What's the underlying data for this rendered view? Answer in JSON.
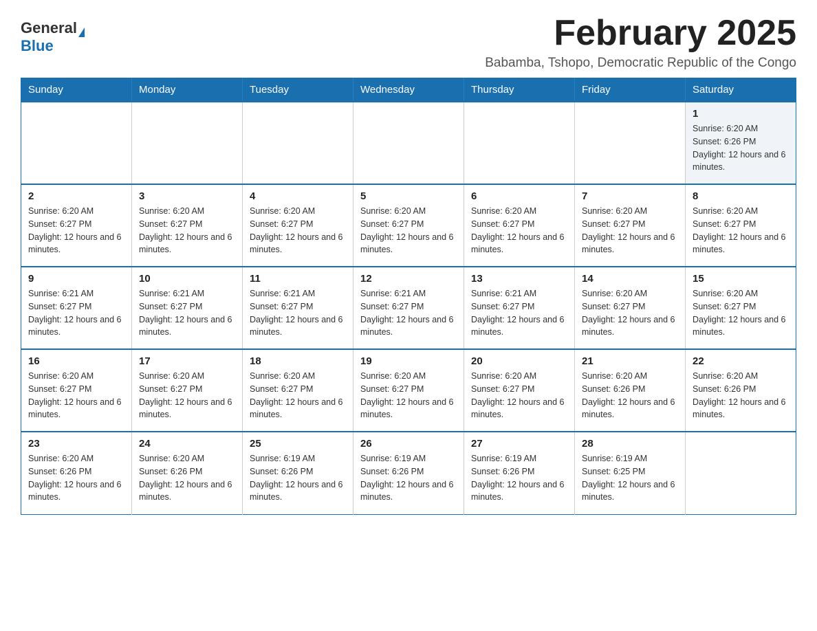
{
  "logo": {
    "general": "General",
    "blue": "Blue"
  },
  "header": {
    "month_year": "February 2025",
    "location": "Babamba, Tshopo, Democratic Republic of the Congo"
  },
  "weekdays": [
    "Sunday",
    "Monday",
    "Tuesday",
    "Wednesday",
    "Thursday",
    "Friday",
    "Saturday"
  ],
  "weeks": [
    {
      "days": [
        {
          "number": "",
          "info": ""
        },
        {
          "number": "",
          "info": ""
        },
        {
          "number": "",
          "info": ""
        },
        {
          "number": "",
          "info": ""
        },
        {
          "number": "",
          "info": ""
        },
        {
          "number": "",
          "info": ""
        },
        {
          "number": "1",
          "info": "Sunrise: 6:20 AM\nSunset: 6:26 PM\nDaylight: 12 hours and 6 minutes."
        }
      ]
    },
    {
      "days": [
        {
          "number": "2",
          "info": "Sunrise: 6:20 AM\nSunset: 6:27 PM\nDaylight: 12 hours and 6 minutes."
        },
        {
          "number": "3",
          "info": "Sunrise: 6:20 AM\nSunset: 6:27 PM\nDaylight: 12 hours and 6 minutes."
        },
        {
          "number": "4",
          "info": "Sunrise: 6:20 AM\nSunset: 6:27 PM\nDaylight: 12 hours and 6 minutes."
        },
        {
          "number": "5",
          "info": "Sunrise: 6:20 AM\nSunset: 6:27 PM\nDaylight: 12 hours and 6 minutes."
        },
        {
          "number": "6",
          "info": "Sunrise: 6:20 AM\nSunset: 6:27 PM\nDaylight: 12 hours and 6 minutes."
        },
        {
          "number": "7",
          "info": "Sunrise: 6:20 AM\nSunset: 6:27 PM\nDaylight: 12 hours and 6 minutes."
        },
        {
          "number": "8",
          "info": "Sunrise: 6:20 AM\nSunset: 6:27 PM\nDaylight: 12 hours and 6 minutes."
        }
      ]
    },
    {
      "days": [
        {
          "number": "9",
          "info": "Sunrise: 6:21 AM\nSunset: 6:27 PM\nDaylight: 12 hours and 6 minutes."
        },
        {
          "number": "10",
          "info": "Sunrise: 6:21 AM\nSunset: 6:27 PM\nDaylight: 12 hours and 6 minutes."
        },
        {
          "number": "11",
          "info": "Sunrise: 6:21 AM\nSunset: 6:27 PM\nDaylight: 12 hours and 6 minutes."
        },
        {
          "number": "12",
          "info": "Sunrise: 6:21 AM\nSunset: 6:27 PM\nDaylight: 12 hours and 6 minutes."
        },
        {
          "number": "13",
          "info": "Sunrise: 6:21 AM\nSunset: 6:27 PM\nDaylight: 12 hours and 6 minutes."
        },
        {
          "number": "14",
          "info": "Sunrise: 6:20 AM\nSunset: 6:27 PM\nDaylight: 12 hours and 6 minutes."
        },
        {
          "number": "15",
          "info": "Sunrise: 6:20 AM\nSunset: 6:27 PM\nDaylight: 12 hours and 6 minutes."
        }
      ]
    },
    {
      "days": [
        {
          "number": "16",
          "info": "Sunrise: 6:20 AM\nSunset: 6:27 PM\nDaylight: 12 hours and 6 minutes."
        },
        {
          "number": "17",
          "info": "Sunrise: 6:20 AM\nSunset: 6:27 PM\nDaylight: 12 hours and 6 minutes."
        },
        {
          "number": "18",
          "info": "Sunrise: 6:20 AM\nSunset: 6:27 PM\nDaylight: 12 hours and 6 minutes."
        },
        {
          "number": "19",
          "info": "Sunrise: 6:20 AM\nSunset: 6:27 PM\nDaylight: 12 hours and 6 minutes."
        },
        {
          "number": "20",
          "info": "Sunrise: 6:20 AM\nSunset: 6:27 PM\nDaylight: 12 hours and 6 minutes."
        },
        {
          "number": "21",
          "info": "Sunrise: 6:20 AM\nSunset: 6:26 PM\nDaylight: 12 hours and 6 minutes."
        },
        {
          "number": "22",
          "info": "Sunrise: 6:20 AM\nSunset: 6:26 PM\nDaylight: 12 hours and 6 minutes."
        }
      ]
    },
    {
      "days": [
        {
          "number": "23",
          "info": "Sunrise: 6:20 AM\nSunset: 6:26 PM\nDaylight: 12 hours and 6 minutes."
        },
        {
          "number": "24",
          "info": "Sunrise: 6:20 AM\nSunset: 6:26 PM\nDaylight: 12 hours and 6 minutes."
        },
        {
          "number": "25",
          "info": "Sunrise: 6:19 AM\nSunset: 6:26 PM\nDaylight: 12 hours and 6 minutes."
        },
        {
          "number": "26",
          "info": "Sunrise: 6:19 AM\nSunset: 6:26 PM\nDaylight: 12 hours and 6 minutes."
        },
        {
          "number": "27",
          "info": "Sunrise: 6:19 AM\nSunset: 6:26 PM\nDaylight: 12 hours and 6 minutes."
        },
        {
          "number": "28",
          "info": "Sunrise: 6:19 AM\nSunset: 6:25 PM\nDaylight: 12 hours and 6 minutes."
        },
        {
          "number": "",
          "info": ""
        }
      ]
    }
  ]
}
